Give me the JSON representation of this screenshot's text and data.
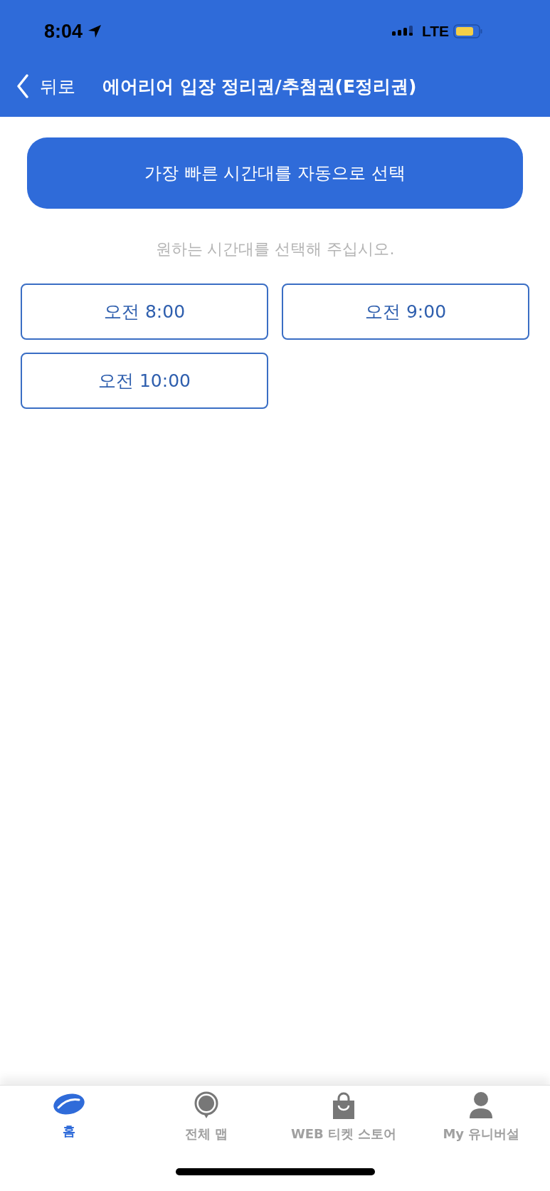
{
  "status_bar": {
    "time": "8:04",
    "network": "LTE"
  },
  "nav": {
    "back": "뒤로",
    "title": "에어리어 입장 정리권/추첨권(E정리권)"
  },
  "auto_button": "가장 빠른 시간대를 자동으로 선택",
  "hint": "원하는 시간대를 선택해 주십시오.",
  "time_slots": [
    {
      "label": "오전 8:00"
    },
    {
      "label": "오전 9:00"
    },
    {
      "label": "오전 10:00"
    }
  ],
  "tab_bar": [
    {
      "kind": "home",
      "label": "홈",
      "selected": true
    },
    {
      "kind": "map",
      "label": "전체 맵",
      "selected": false
    },
    {
      "kind": "store",
      "label": "WEB 티켓 스토어",
      "selected": false
    },
    {
      "kind": "profile",
      "label": "My 유니버설",
      "selected": false
    }
  ]
}
